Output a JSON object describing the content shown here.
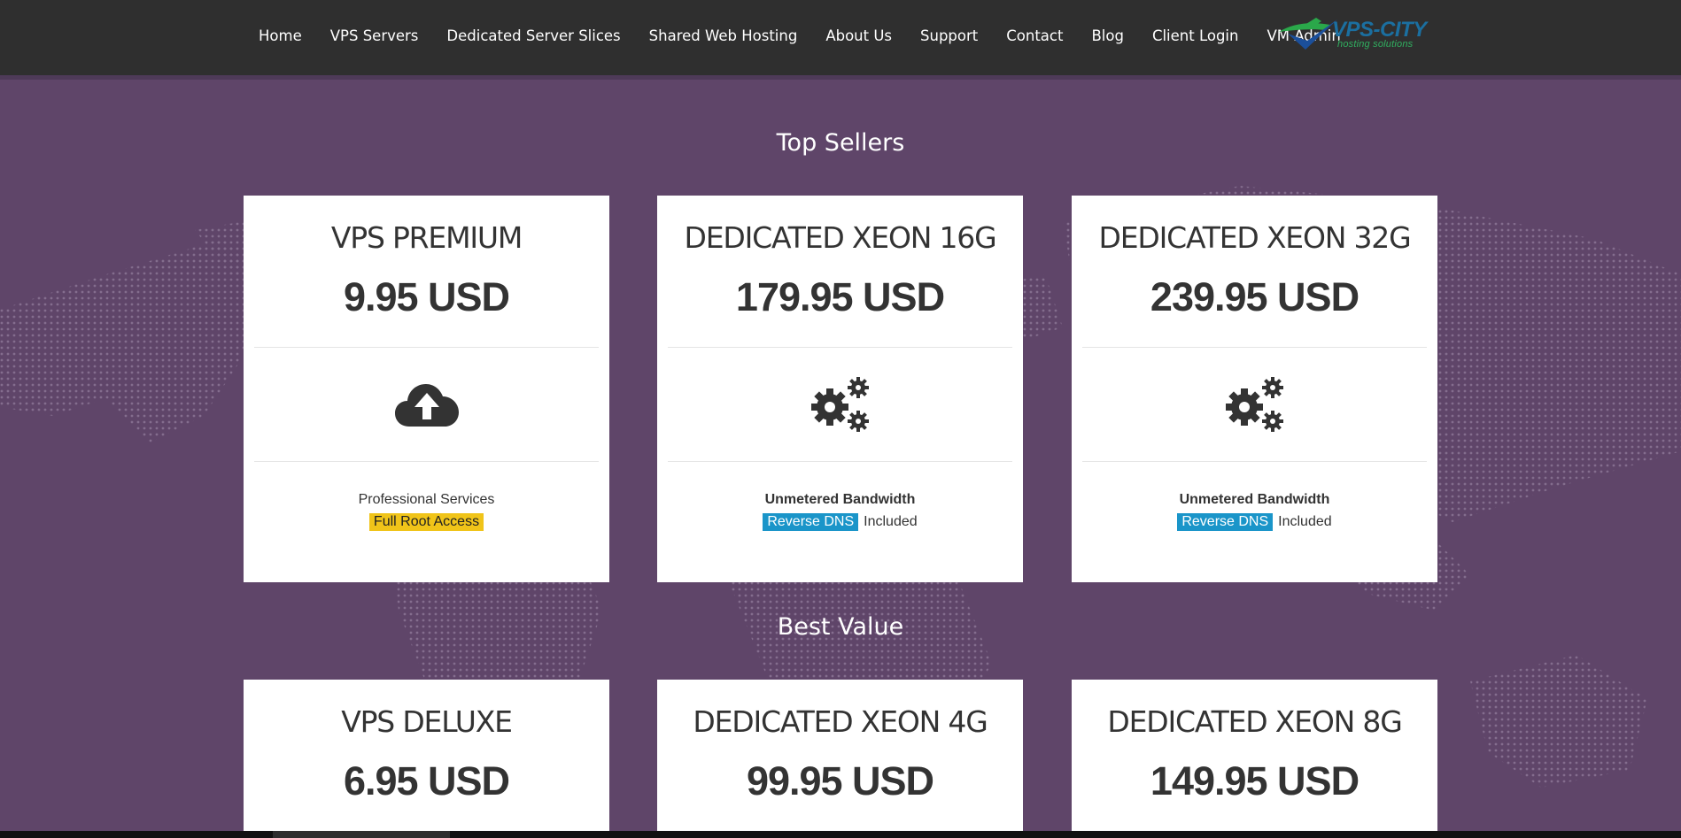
{
  "nav": {
    "items": [
      {
        "label": "Home",
        "name": "nav-home"
      },
      {
        "label": "VPS Servers",
        "name": "nav-vps-servers"
      },
      {
        "label": "Dedicated Server Slices",
        "name": "nav-dedicated-server-slices"
      },
      {
        "label": "Shared Web Hosting",
        "name": "nav-shared-web-hosting"
      },
      {
        "label": "About Us",
        "name": "nav-about-us"
      },
      {
        "label": "Support",
        "name": "nav-support"
      },
      {
        "label": "Contact",
        "name": "nav-contact"
      },
      {
        "label": "Blog",
        "name": "nav-blog"
      },
      {
        "label": "Client Login",
        "name": "nav-client-login"
      },
      {
        "label": "VM Admin",
        "name": "nav-vm-admin"
      }
    ]
  },
  "logo": {
    "text": "VPS-CITY",
    "subtext": "hosting solutions",
    "icon": "plane-logo-icon"
  },
  "colors": {
    "header_bg": "#2f2f2f",
    "page_bg": "#5f4569",
    "badge_yellow": "#f0c419",
    "badge_blue": "#1a95c9"
  },
  "sections": {
    "top_sellers": {
      "title": "Top Sellers",
      "cards": [
        {
          "title": "VPS PREMIUM",
          "price": "9.95 USD",
          "icon": "cloud-upload-icon",
          "feature_line1": "Professional Services",
          "badge": "Full Root Access"
        },
        {
          "title": "DEDICATED XEON 16G",
          "price": "179.95 USD",
          "icon": "gears-icon",
          "feature_line1": "Unmetered Bandwidth",
          "badge": "Reverse DNS",
          "badge_suffix": "Included"
        },
        {
          "title": "DEDICATED XEON 32G",
          "price": "239.95 USD",
          "icon": "gears-icon",
          "feature_line1": "Unmetered Bandwidth",
          "badge": "Reverse DNS",
          "badge_suffix": "Included"
        }
      ]
    },
    "best_value": {
      "title": "Best Value",
      "cards": [
        {
          "title": "VPS DELUXE",
          "price": "6.95 USD"
        },
        {
          "title": "DEDICATED XEON 4G",
          "price": "99.95 USD"
        },
        {
          "title": "DEDICATED XEON 8G",
          "price": "149.95 USD"
        }
      ]
    }
  }
}
